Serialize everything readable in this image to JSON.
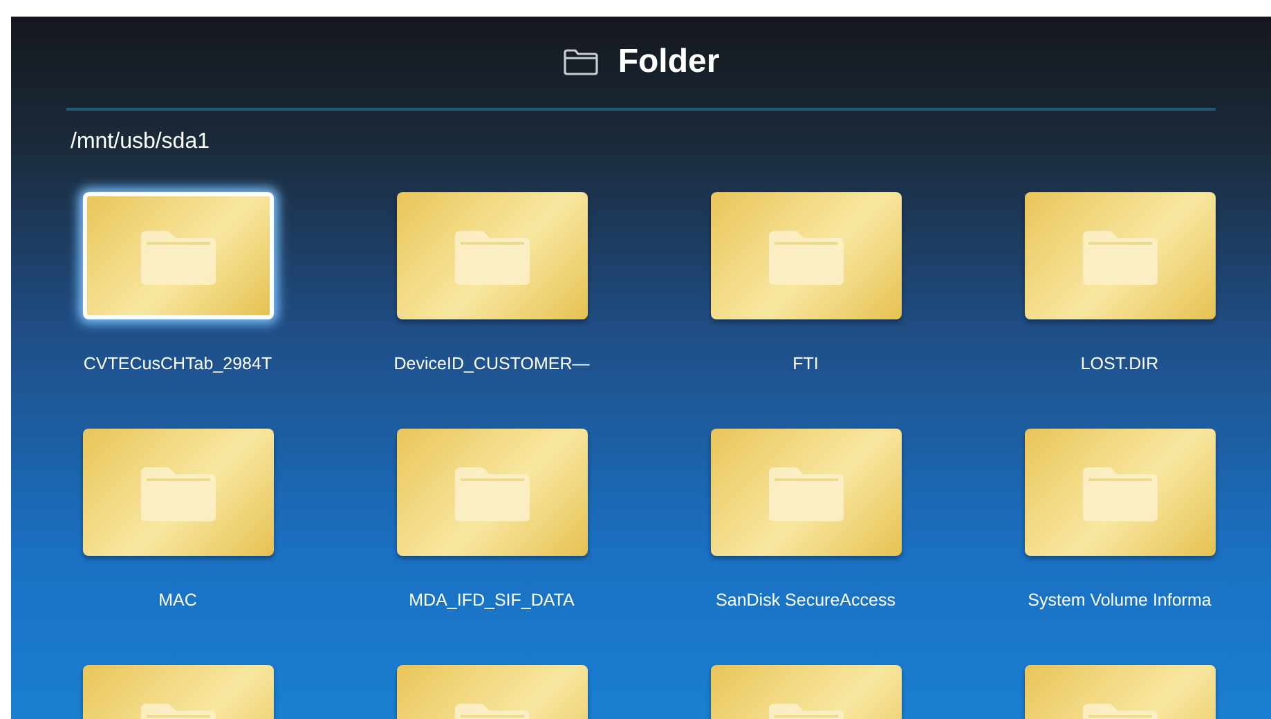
{
  "header": {
    "title": "Folder"
  },
  "path": "/mnt/usb/sda1",
  "folders": [
    {
      "name": "CVTECusCHTab_2984T",
      "selected": true
    },
    {
      "name": "DeviceID_CUSTOMER—",
      "selected": false
    },
    {
      "name": "FTI",
      "selected": false
    },
    {
      "name": "LOST.DIR",
      "selected": false
    },
    {
      "name": "MAC",
      "selected": false
    },
    {
      "name": "MDA_IFD_SIF_DATA",
      "selected": false
    },
    {
      "name": "SanDisk SecureAccess",
      "selected": false
    },
    {
      "name": "System Volume Informa",
      "selected": false
    },
    {
      "selected": false
    },
    {
      "selected": false
    },
    {
      "selected": false
    },
    {
      "selected": false
    }
  ]
}
